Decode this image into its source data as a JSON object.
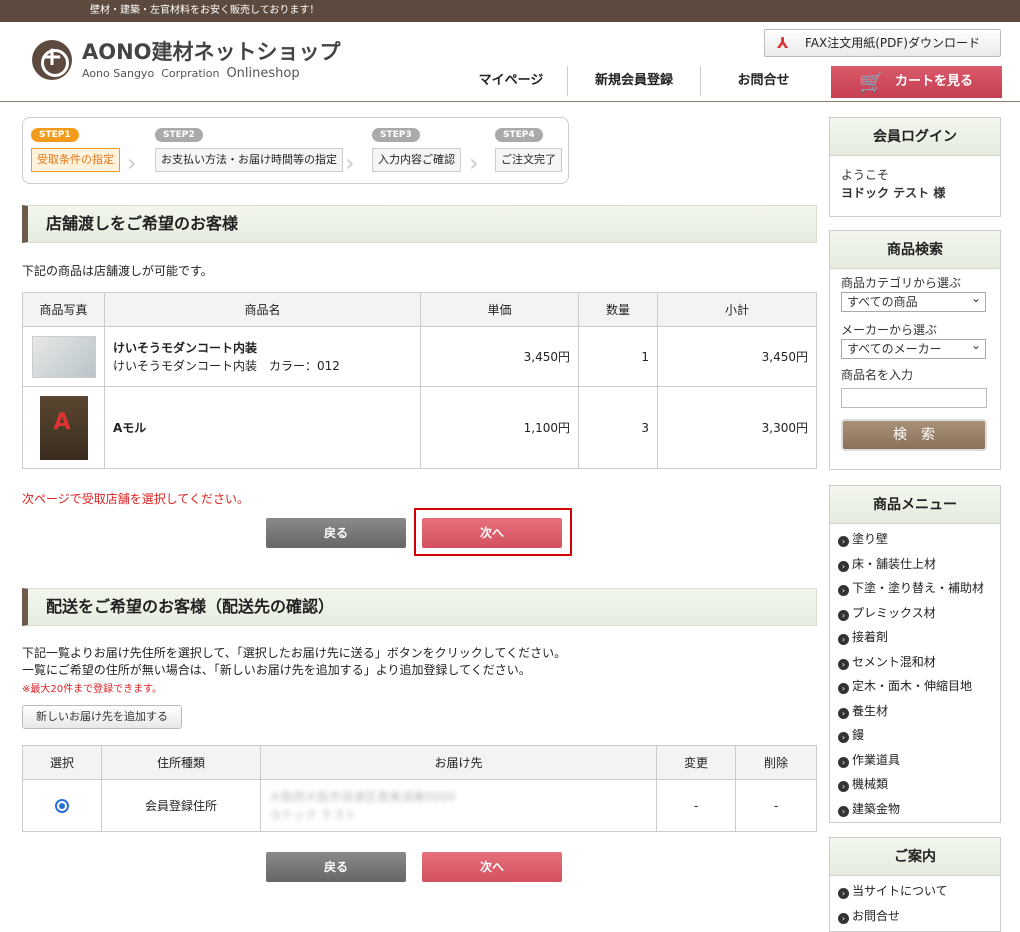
{
  "topbar": {
    "tagline": "壁材・建築・左官材料をお安く販売しております！"
  },
  "header": {
    "logo_title": "AONO建材ネットショップ",
    "logo_sub_a": "Aono Sangyo",
    "logo_sub_b": "Corpration",
    "logo_sub_c": "Onlineshop",
    "fax_label": "FAX注文用紙(PDF)ダウンロード",
    "nav": [
      "マイページ",
      "新規会員登録",
      "お問合せ"
    ],
    "cart_label": "カートを見る"
  },
  "steps": [
    {
      "tag": "STEP1",
      "label": "受取条件の指定"
    },
    {
      "tag": "STEP2",
      "label": "お支払い方法・お届け時間等の指定"
    },
    {
      "tag": "STEP3",
      "label": "入力内容ご確認"
    },
    {
      "tag": "STEP4",
      "label": "ご注文完了"
    }
  ],
  "store": {
    "heading": "店舗渡しをご希望のお客様",
    "intro": "下記の商品は店舗渡しが可能です。",
    "columns": [
      "商品写真",
      "商品名",
      "単価",
      "数量",
      "小計"
    ],
    "rows": [
      {
        "name": "けいそうモダンコート内装",
        "detail": "けいそうモダンコート内装　カラー：012",
        "price": "3,450円",
        "qty": "1",
        "subtotal": "3,450円"
      },
      {
        "name": "Aモル",
        "detail": "",
        "price": "1,100円",
        "qty": "3",
        "subtotal": "3,300円"
      }
    ],
    "notice": "次ページで受取店舗を選択してください。",
    "back": "戻る",
    "next": "次へ"
  },
  "delivery": {
    "heading": "配送をご希望のお客様（配送先の確認）",
    "line1": "下記一覧よりお届け先住所を選択して、「選択したお届け先に送る」ボタンをクリックしてください。",
    "line2": "一覧にご希望の住所が無い場合は、「新しいお届け先を追加する」より追加登録してください。",
    "limit": "※最大20件まで登録できます。",
    "add_btn": "新しいお届け先を追加する",
    "columns": [
      "選択",
      "住所種類",
      "お届け先",
      "変更",
      "削除"
    ],
    "row": {
      "type": "会員登録住所",
      "address1": "大阪府大阪市浪速区恵美須東0000",
      "address2": "ヨドック テスト",
      "change": "-",
      "delete": "-"
    },
    "back": "戻る",
    "next": "次へ"
  },
  "sidebar": {
    "login_title": "会員ログイン",
    "welcome": "ようこそ",
    "user": "ヨドック テスト 様",
    "search_title": "商品検索",
    "cat_label": "商品カテゴリから選ぶ",
    "cat_value": "すべての商品",
    "maker_label": "メーカーから選ぶ",
    "maker_value": "すべてのメーカー",
    "name_label": "商品名を入力",
    "search_btn": "検　索",
    "menu_title": "商品メニュー",
    "menu": [
      "塗り壁",
      "床・舗装仕上材",
      "下塗・塗り替え・補助材",
      "プレミックス材",
      "接着剤",
      "セメント混和材",
      "定木・面木・伸縮目地",
      "養生材",
      "鏝",
      "作業道具",
      "機械類",
      "建築金物"
    ],
    "info_title": "ご案内",
    "info": [
      "当サイトについて",
      "お問合せ"
    ]
  },
  "colors": {
    "brand_brown": "#5d4a3e",
    "accent_red": "#d2505f",
    "step_orange": "#f39c1c"
  }
}
